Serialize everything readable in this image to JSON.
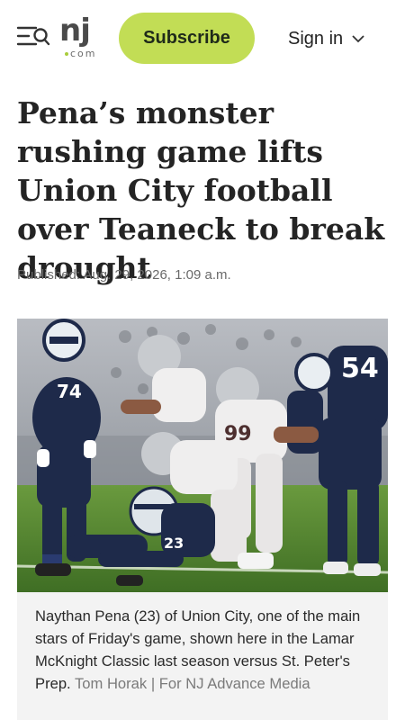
{
  "header": {
    "menu_icon": "menu-search-icon",
    "logo_main": "nj",
    "logo_sub": "com",
    "subscribe_label": "Subscribe",
    "signin_label": "Sign in",
    "accent_color": "#c2dd55"
  },
  "article": {
    "headline": "Pena’s monster rushing game lifts Union City football over Teaneck to break drought",
    "published": "Published: Aug. 29, 2026, 1:09 a.m."
  },
  "photo": {
    "jersey_numbers": [
      "74",
      "54",
      "23",
      "99"
    ],
    "caption": "Naythan Pena (23) of Union City, one of the main stars of Friday's game, shown here in the Lamar McKnight Classic last season versus St. Peter's Prep.",
    "credit": "Tom Horak | For NJ Advance Media"
  }
}
